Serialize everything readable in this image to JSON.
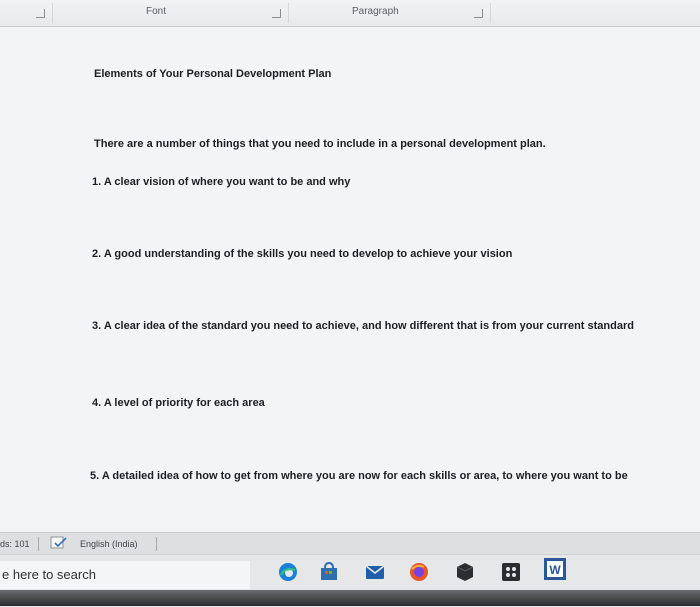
{
  "ribbon": {
    "groups": [
      {
        "label": "Font"
      },
      {
        "label": "Paragraph"
      }
    ]
  },
  "document": {
    "title": "Elements of Your Personal Development Plan",
    "intro": "There are a number of things that you need to include in a personal development plan.",
    "items": [
      "1. A clear vision of where you want to be and why",
      "2. A good understanding of the skills you need to develop to achieve your vision",
      "3. A clear idea of the standard you need to achieve, and how different that is from your current standard",
      "4. A level of priority for each area",
      "5. A detailed idea of how to get from where you are now for each skills or area, to where you want to be"
    ]
  },
  "status_bar": {
    "word_count": "ds: 101",
    "language": "English (India)"
  },
  "taskbar": {
    "search_placeholder": "e here to search",
    "apps": [
      "edge-icon",
      "store-icon",
      "mail-icon",
      "firefox-icon",
      "dell-icon",
      "xbox-icon",
      "word-icon"
    ],
    "colors": {
      "edge": "#1a7fd6",
      "word": "#2b5797",
      "firefox": "#e8552a",
      "mail": "#1f5fa8"
    }
  }
}
